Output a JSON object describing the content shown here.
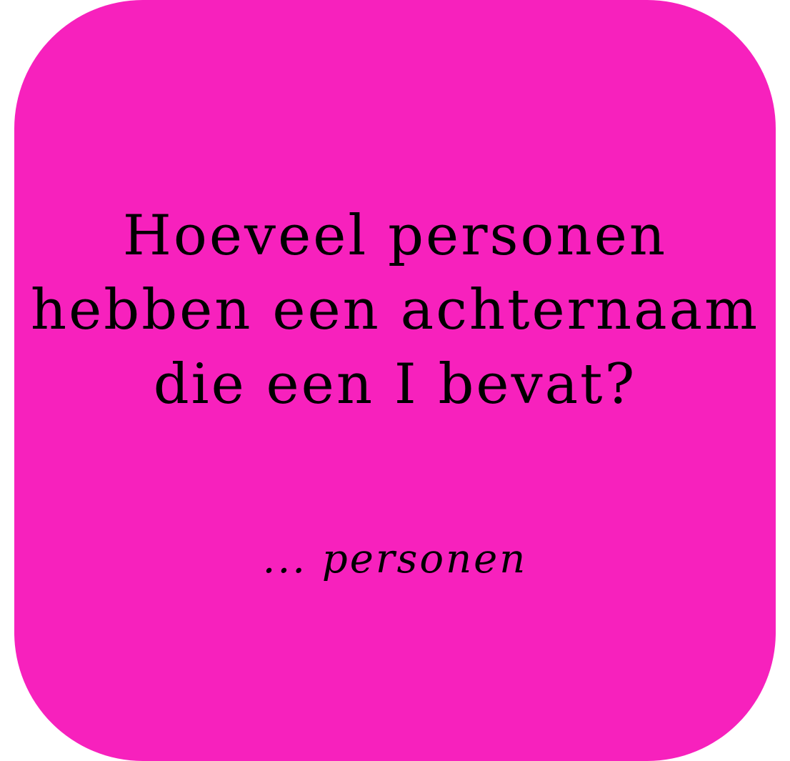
{
  "card": {
    "background_color": "#f721bd",
    "question_lines": [
      "Hoeveel personen",
      "hebben een achternaam",
      "die een I bevat?"
    ],
    "answer_placeholder": "... personen"
  }
}
